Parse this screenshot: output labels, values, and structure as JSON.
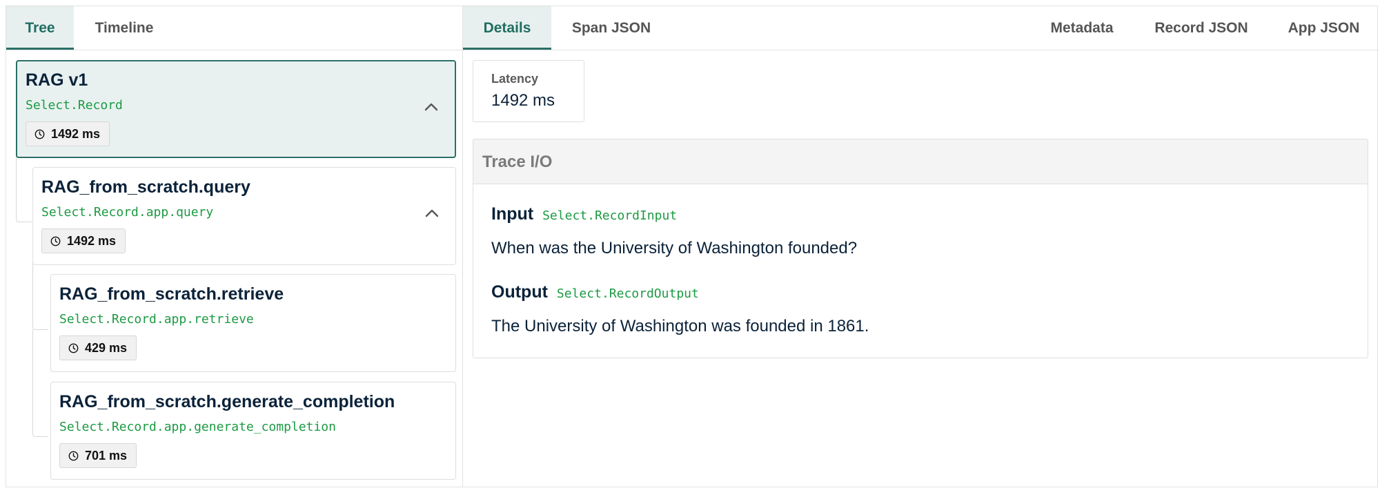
{
  "left_tabs": [
    {
      "label": "Tree",
      "active": true
    },
    {
      "label": "Timeline",
      "active": false
    }
  ],
  "right_tabs_left": [
    {
      "label": "Details",
      "active": true
    },
    {
      "label": "Span JSON",
      "active": false
    }
  ],
  "right_tabs_right": [
    {
      "label": "Metadata"
    },
    {
      "label": "Record JSON"
    },
    {
      "label": "App JSON"
    }
  ],
  "tree": {
    "nodes": [
      {
        "title": "RAG v1",
        "path": "Select.Record",
        "duration": "1492 ms",
        "selected": true,
        "expandable": true
      },
      {
        "title": "RAG_from_scratch.query",
        "path": "Select.Record.app.query",
        "duration": "1492 ms",
        "selected": false,
        "expandable": true
      },
      {
        "title": "RAG_from_scratch.retrieve",
        "path": "Select.Record.app.retrieve",
        "duration": "429 ms",
        "selected": false,
        "expandable": false
      },
      {
        "title": "RAG_from_scratch.generate_completion",
        "path": "Select.Record.app.generate_completion",
        "duration": "701 ms",
        "selected": false,
        "expandable": false
      }
    ]
  },
  "details": {
    "latency_label": "Latency",
    "latency_value": "1492 ms",
    "trace_title": "Trace I/O",
    "input_label": "Input",
    "input_path": "Select.RecordInput",
    "input_text": "When was the University of Washington founded?",
    "output_label": "Output",
    "output_path": "Select.RecordOutput",
    "output_text": "The University of Washington was founded in 1861."
  },
  "colors": {
    "accent": "#2b6f66",
    "path_green": "#1c9a43",
    "text_dark": "#0b2239"
  },
  "icons": {
    "duration": "clock-icon",
    "collapse": "chevron-up-icon"
  }
}
